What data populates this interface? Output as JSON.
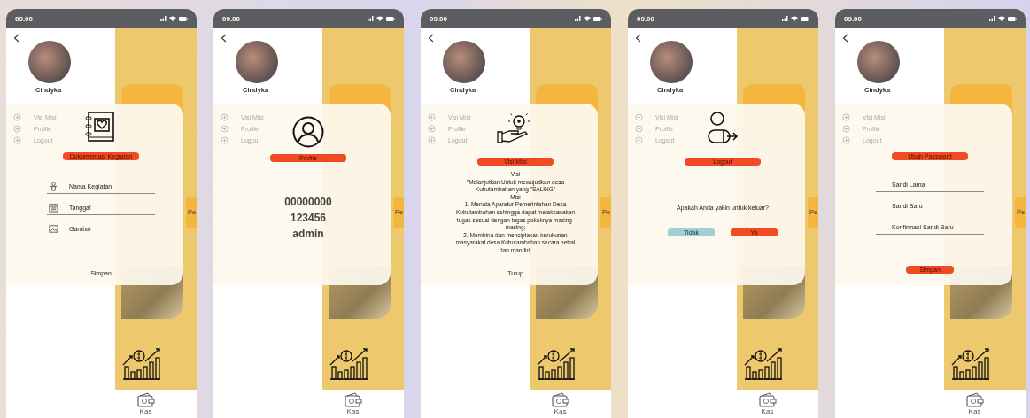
{
  "phones": [
    {
      "status_time": "09.00",
      "drawer": {
        "name": "Cindyka",
        "menu": [
          "Visi Misi",
          "Profile",
          "Logout"
        ]
      },
      "side_card_label": "Pe",
      "nav_label": "Kas",
      "dialog": {
        "kind": "activity",
        "title": "Dokumentasi Kegiatan",
        "fields": [
          {
            "label": "Nama Kegiatan",
            "kind": "activity"
          },
          {
            "label": "Tanggal",
            "kind": "date"
          },
          {
            "label": "Gambar",
            "kind": "image"
          }
        ],
        "action": {
          "label": "Simpan",
          "kind": "text"
        }
      }
    },
    {
      "status_time": "09.00",
      "drawer": {
        "name": "Cindyka",
        "menu": [
          "Visi Misi",
          "Profile",
          "Logout"
        ]
      },
      "side_card_label": "Pe",
      "nav_label": "Kas",
      "dialog": {
        "kind": "profile",
        "title": "Profile",
        "lines": [
          "00000000",
          "123456",
          "admin"
        ]
      }
    },
    {
      "status_time": "09.00",
      "drawer": {
        "name": "Cindyka",
        "menu": [
          "Visi Misi",
          "Profile",
          "Logout"
        ]
      },
      "side_card_label": "Pe",
      "nav_label": "Kas",
      "dialog": {
        "kind": "vision",
        "title": "Visi Misi",
        "paragraphs": [
          "Visi",
          "\"Melanjutkan Untuk mewujudkan desa Kubutambahan yang \"SALING\"",
          "Misi",
          "1. Menata Aparatur Pemerintahan Desa Kubutambahan sehingga dapat melaksanakan tugas sesuai dengan tugas pokoknya masing-masing;",
          "2. Membina dan menciptakan kerukunan masyarakat desa Kubutambahan secara netral dan mandiri;"
        ],
        "action": {
          "label": "Tutup",
          "kind": "text"
        }
      }
    },
    {
      "status_time": "09.00",
      "drawer": {
        "name": "Cindyka",
        "menu": [
          "Visi Misi",
          "Profile",
          "Logout"
        ]
      },
      "side_card_label": "Pe",
      "nav_label": "Kas",
      "dialog": {
        "kind": "logout",
        "title": "Logout",
        "question": "Apakah Anda yakin untuk keluar?",
        "buttons": [
          {
            "label": "Tidak",
            "kind": "secondary"
          },
          {
            "label": "Ya",
            "kind": "primary"
          }
        ]
      }
    },
    {
      "status_time": "09.00",
      "drawer": {
        "name": "Cindyka",
        "menu": [
          "Visi Misi",
          "Profile",
          "Logout"
        ]
      },
      "side_card_label": "Pe",
      "nav_label": "Kas",
      "dialog": {
        "kind": "password",
        "title": "Ubah Password",
        "fields": [
          {
            "label": "Sandi Lama",
            "kind": "password"
          },
          {
            "label": "Sandi Baru",
            "kind": "password"
          },
          {
            "label": "Konfirmasi Sandi Baru",
            "kind": "password"
          }
        ],
        "action": {
          "label": "Simpan",
          "kind": "filled"
        }
      }
    }
  ]
}
